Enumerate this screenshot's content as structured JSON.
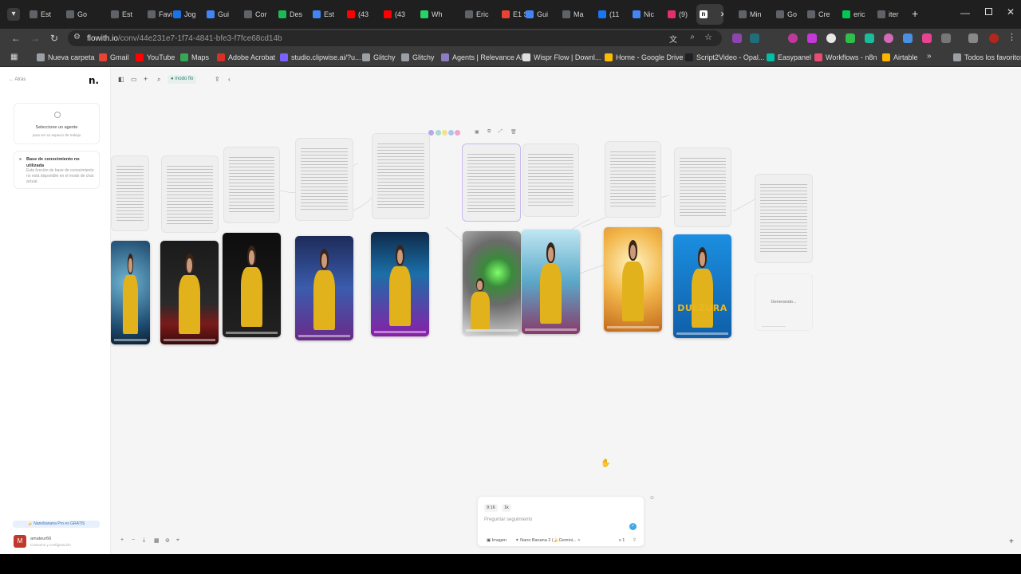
{
  "tabs": [
    {
      "label": "Est",
      "color": "#5f6368"
    },
    {
      "label": "Go",
      "color": "#5f6368"
    },
    {
      "label": "Est",
      "color": "#5f6368"
    },
    {
      "label": "Favi",
      "color": "#5f6368"
    },
    {
      "label": "Jog",
      "color": "#1a73e8"
    },
    {
      "label": "Gui",
      "color": "#4285f4"
    },
    {
      "label": "Cor",
      "color": "#5f6368"
    },
    {
      "label": "Des",
      "color": "#1db954"
    },
    {
      "label": "Est",
      "color": "#4285f4"
    },
    {
      "label": "(43",
      "color": "#ff0000"
    },
    {
      "label": "(43",
      "color": "#ff0000"
    },
    {
      "label": "Wh",
      "color": "#25d366"
    },
    {
      "label": "Eric",
      "color": "#5f6368"
    },
    {
      "label": "E1 S",
      "color": "#ea4335"
    },
    {
      "label": "Gui",
      "color": "#4285f4"
    },
    {
      "label": "Ma",
      "color": "#5f6368"
    },
    {
      "label": "(11",
      "color": "#1877f2"
    },
    {
      "label": "Nic",
      "color": "#4285f4"
    },
    {
      "label": "(9)",
      "color": "#e1306c"
    },
    {
      "label": "",
      "color": "#ffffff",
      "active": true
    },
    {
      "label": "Min",
      "color": "#5f6368"
    },
    {
      "label": "Go",
      "color": "#5f6368"
    },
    {
      "label": "Cre",
      "color": "#5f6368"
    },
    {
      "label": "eric",
      "color": "#00c853"
    },
    {
      "label": "iter",
      "color": "#5f6368"
    }
  ],
  "address": {
    "host": "flowith.io",
    "path": "/conv/44e231e7-1f74-4841-bfe3-f7fce68cd14b"
  },
  "bookmarks": [
    {
      "label": "Nueva carpeta",
      "color": "#9aa0a6"
    },
    {
      "label": "Gmail",
      "color": "#ea4335"
    },
    {
      "label": "YouTube",
      "color": "#ff0000"
    },
    {
      "label": "Maps",
      "color": "#34a853"
    },
    {
      "label": "Adobe Acrobat",
      "color": "#d93025"
    },
    {
      "label": "studio.clipwise.ai/?u...",
      "color": "#7b61ff"
    },
    {
      "label": "Glitchy",
      "color": "#9aa0a6"
    },
    {
      "label": "Glitchy",
      "color": "#9aa0a6"
    },
    {
      "label": "Agents | Relevance AI",
      "color": "#8e7cc3"
    },
    {
      "label": "Wispr Flow | Downl...",
      "color": "#e0e0e0"
    },
    {
      "label": "Home - Google Drive",
      "color": "#fbbc04"
    },
    {
      "label": "Script2Video - Opal...",
      "color": "#202124"
    },
    {
      "label": "Easypanel",
      "color": "#00bfa5"
    },
    {
      "label": "Workflows - n8n",
      "color": "#ea4b71"
    },
    {
      "label": "Airtable",
      "color": "#fcb400"
    },
    {
      "label": "Todos los favoritos",
      "color": "#9aa0a6"
    }
  ],
  "sidebar": {
    "back_label": "← Atrás",
    "agent_title": "Seleccione un agente",
    "agent_sub": "para ver su espacio de trabajo",
    "kb_title": "Base de conocimiento no utilizada",
    "kb_desc": "Esta función de base de conocimiento no está disponible en el modo de chat actual.",
    "promo": "🍌 Nanobanana Pro es GRATIS",
    "user_name": "amateur66",
    "user_sub": "Consumo y configuración"
  },
  "toolbar": {
    "mode_label": "modo flo"
  },
  "canvas": {
    "generating_label": "Generando...",
    "logo_text": "DULZURA"
  },
  "chatbox": {
    "chip_ratio": "9:16",
    "chip_count": "1k",
    "placeholder": "Preguntar seguimiento",
    "mode_label": "Imagen",
    "model_label": "Nano Banana 2 (🍌Gemini...",
    "qty_label": "x 1"
  },
  "colors": {
    "accent": "#3fa7e6",
    "brand": "#1a1a1a"
  }
}
